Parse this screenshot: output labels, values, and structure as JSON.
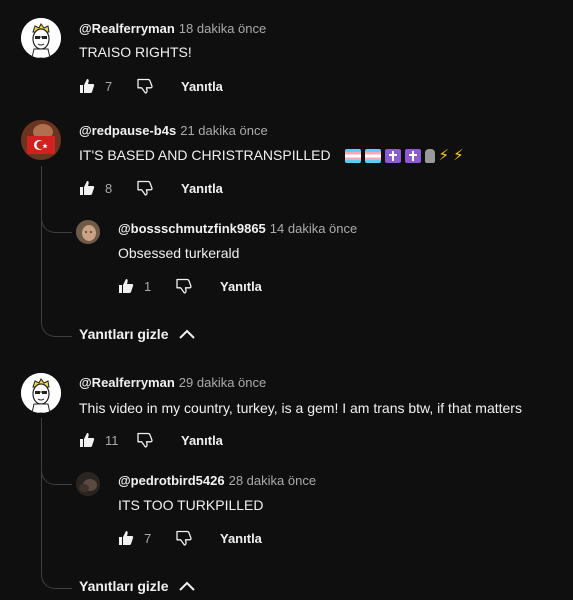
{
  "comments": [
    {
      "author": "@Realferryman",
      "time": "18 dakika önce",
      "text": "TRAISO RIGHTS!",
      "likes": "7",
      "reply_label": "Yanıtla"
    },
    {
      "author": "@redpause-b4s",
      "time": "21 dakika önce",
      "text": "IT'S BASED AND CHRISTRANSPILLED",
      "emoji_icons": [
        "transgender-flag",
        "transgender-flag",
        "latin-cross",
        "latin-cross",
        "moai",
        "lightning",
        "lightning"
      ],
      "likes": "8",
      "reply_label": "Yanıtla",
      "replies": [
        {
          "author": "@bossschmutzfink9865",
          "time": "14 dakika önce",
          "text": "Obsessed turkerald",
          "likes": "1",
          "reply_label": "Yanıtla"
        }
      ],
      "hide_replies_label": "Yanıtları gizle"
    },
    {
      "author": "@Realferryman",
      "time": "29 dakika önce",
      "text": "This video in my country, turkey, is a gem! I am trans btw, if that matters",
      "likes": "11",
      "reply_label": "Yanıtla",
      "replies": [
        {
          "author": "@pedrotbird5426",
          "time": "28 dakika önce",
          "text": "ITS TOO TURKPILLED",
          "likes": "7",
          "reply_label": "Yanıtla"
        }
      ],
      "hide_replies_label": "Yanıtları gizle"
    }
  ],
  "colors": {
    "background": "#0f0f0f",
    "text": "#f1f1f1",
    "secondary_text": "#aaaaaa",
    "thread_line": "#3f3f3f"
  }
}
